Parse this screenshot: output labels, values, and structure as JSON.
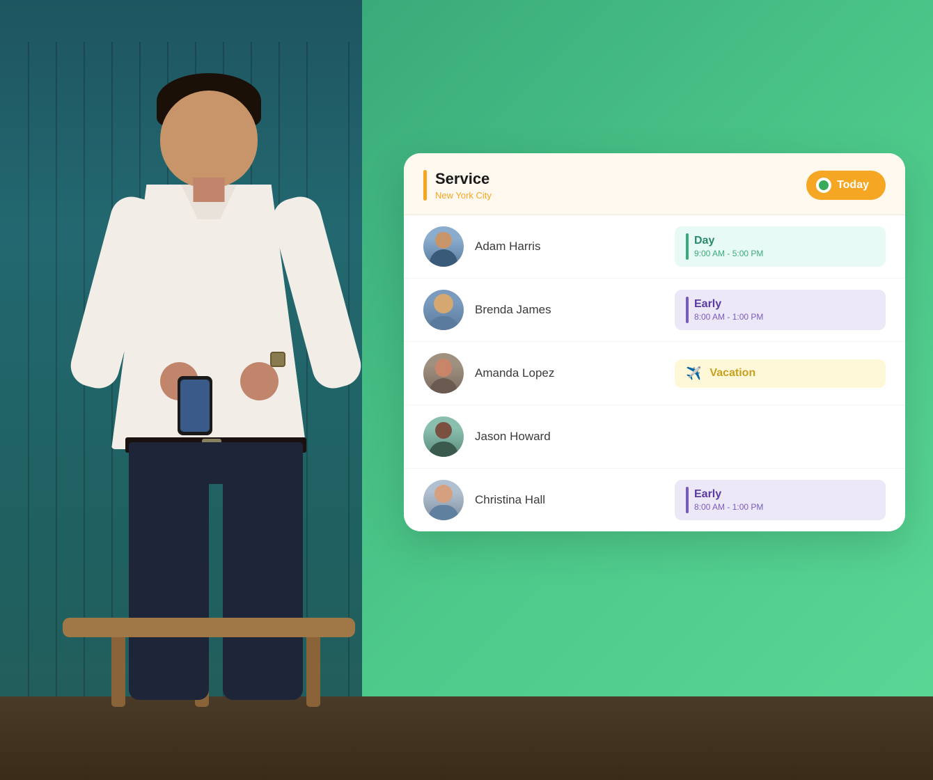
{
  "scene": {
    "background_color": "#2a7070"
  },
  "card": {
    "service_label": "Service",
    "city_label": "New York City",
    "today_label": "Today",
    "employees": [
      {
        "id": "adam",
        "name": "Adam Harris",
        "avatar_label": "Adam Harris avatar",
        "shift_type": "day",
        "shift_name": "Day",
        "shift_time": "9:00 AM - 5:00 PM"
      },
      {
        "id": "brenda",
        "name": "Brenda James",
        "avatar_label": "Brenda James avatar",
        "shift_type": "early",
        "shift_name": "Early",
        "shift_time": "8:00 AM - 1:00 PM"
      },
      {
        "id": "amanda",
        "name": "Amanda Lopez",
        "avatar_label": "Amanda Lopez avatar",
        "shift_type": "vacation",
        "shift_name": "Vacation",
        "shift_time": ""
      },
      {
        "id": "jason",
        "name": "Jason Howard",
        "avatar_label": "Jason Howard avatar",
        "shift_type": "empty",
        "shift_name": "",
        "shift_time": ""
      },
      {
        "id": "christina",
        "name": "Christina Hall",
        "avatar_label": "Christina Hall avatar",
        "shift_type": "early",
        "shift_name": "Early",
        "shift_time": "8:00 AM - 1:00 PM"
      }
    ]
  }
}
